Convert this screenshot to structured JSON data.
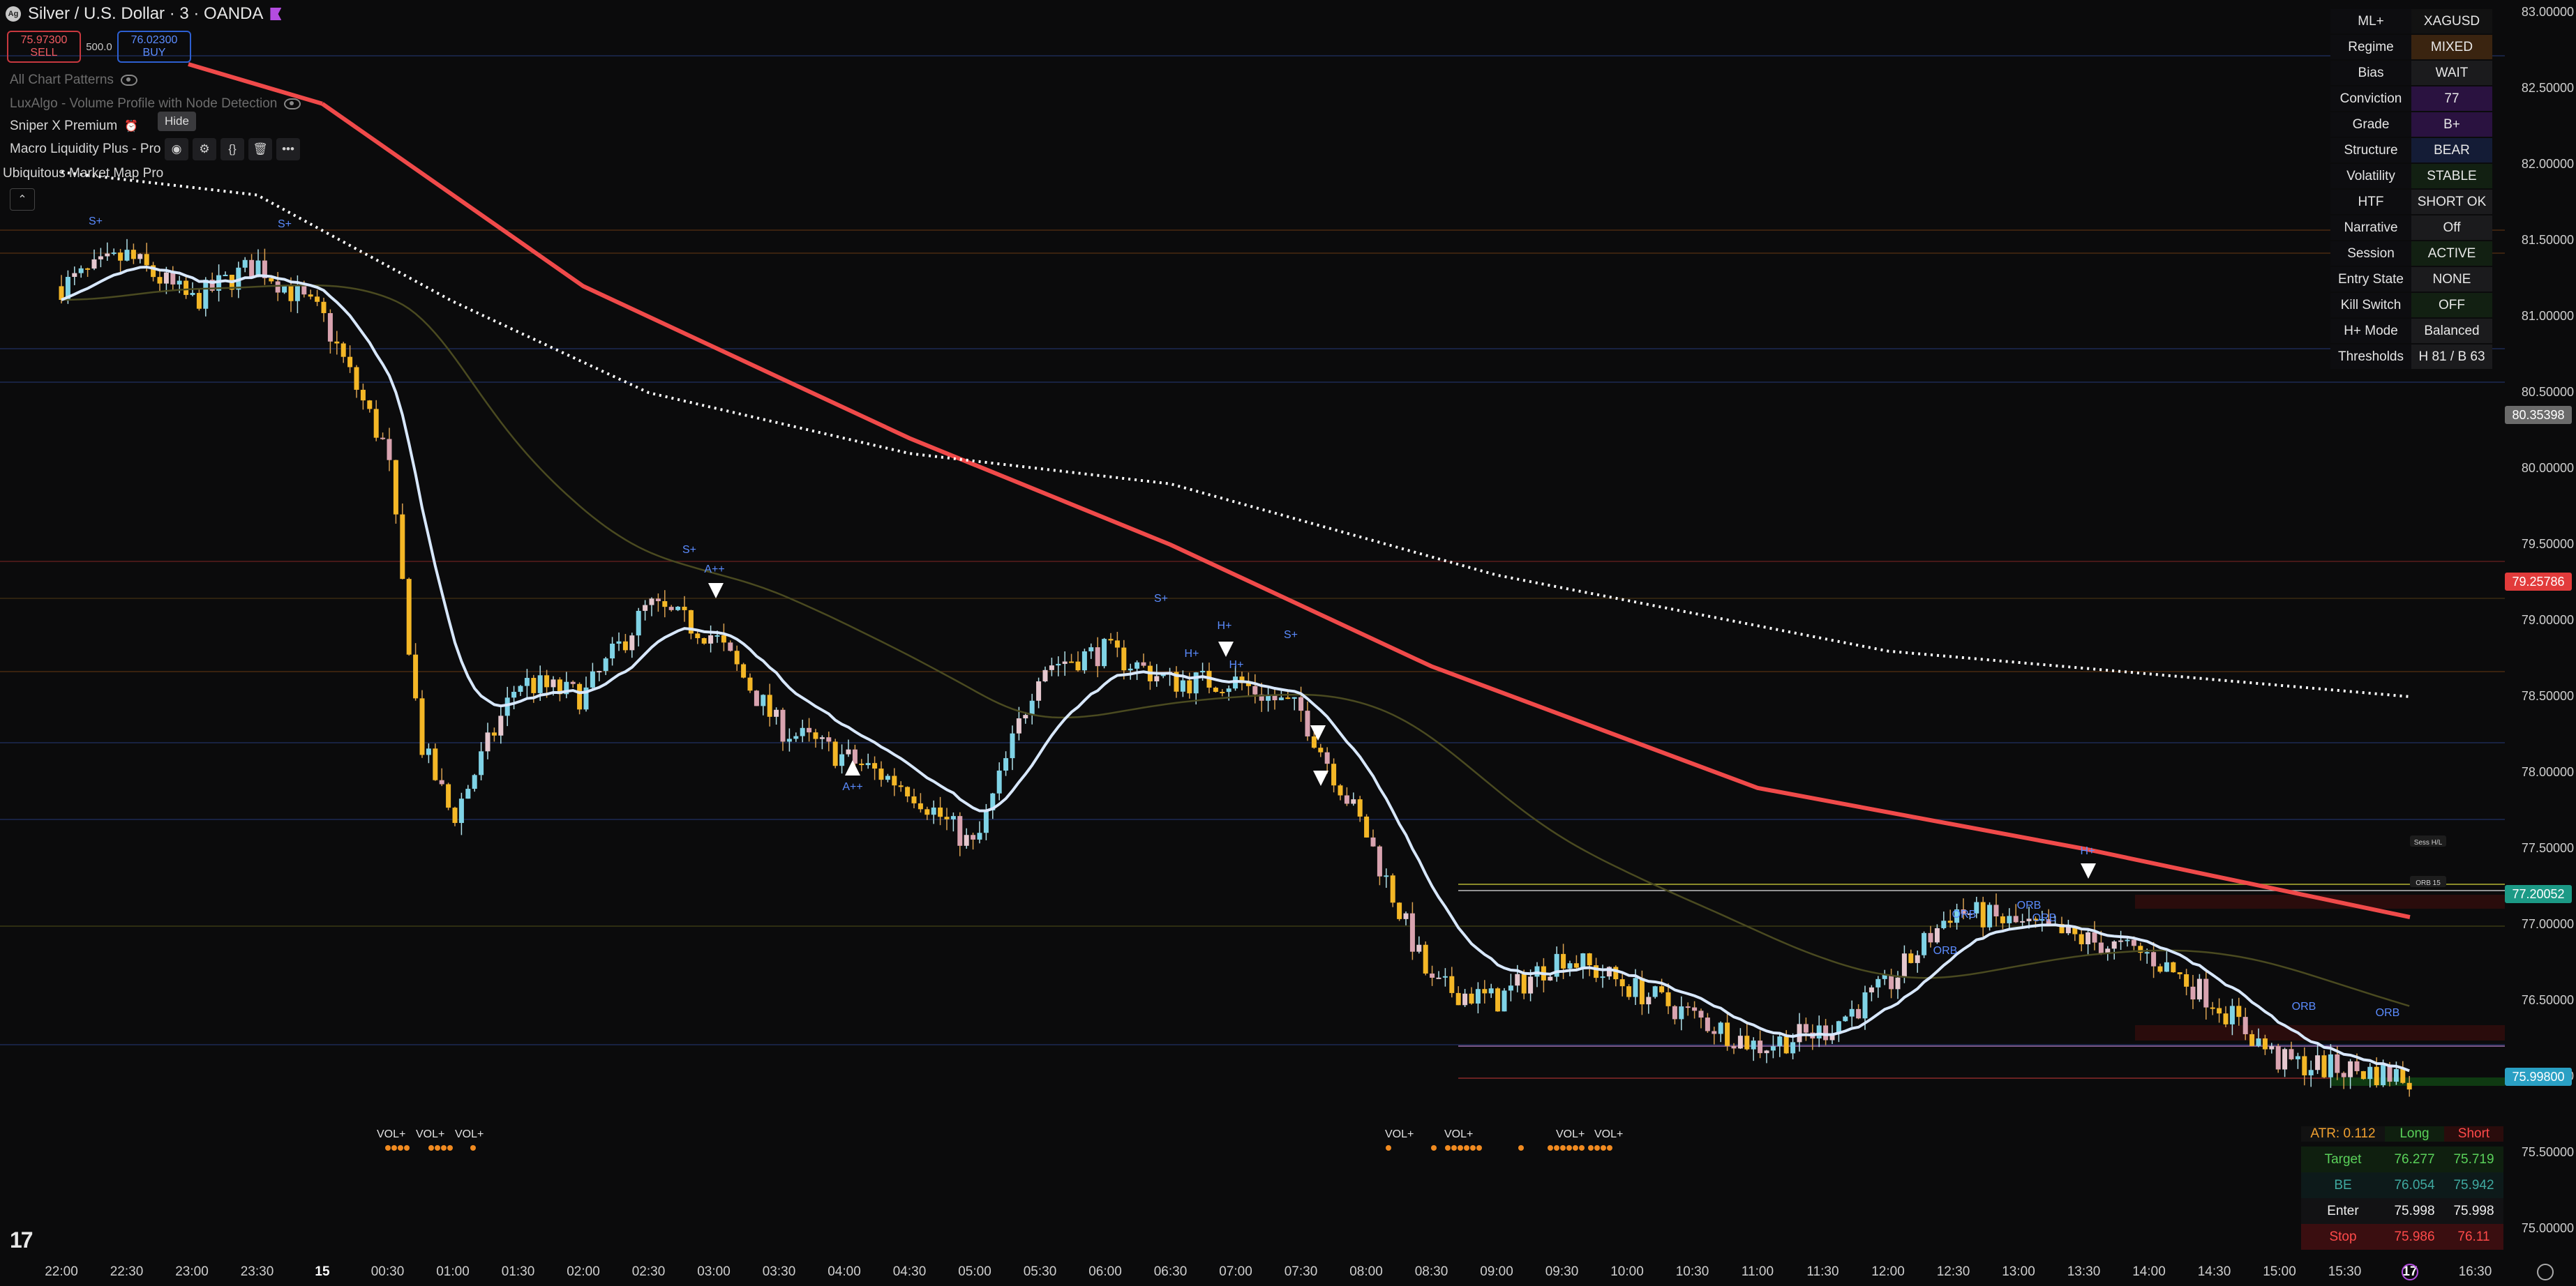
{
  "header": {
    "title": "Silver / U.S. Dollar · 3 · OANDA",
    "sell_price": "75.97300",
    "sell_label": "SELL",
    "qty": "500.0",
    "buy_price": "76.02300",
    "buy_label": "BUY"
  },
  "indicators": {
    "chart_patterns": "All Chart Patterns",
    "luxalgo": "LuxAlgo - Volume Profile with Node Detection",
    "sniper": "Sniper X Premium",
    "macro": "Macro Liquidity Plus - Pro",
    "ubiquitous": "Ubiquitous Market Map Pro",
    "hide_tooltip": "Hide"
  },
  "dashboard": [
    {
      "key": "ML+",
      "value": "XAGUSD",
      "bg": "#121212"
    },
    {
      "key": "Regime",
      "value": "MIXED",
      "bg": "#3a2410"
    },
    {
      "key": "Bias",
      "value": "WAIT",
      "bg": "#1b1b1d"
    },
    {
      "key": "Conviction",
      "value": "77",
      "bg": "#2a1240"
    },
    {
      "key": "Grade",
      "value": "B+",
      "bg": "#2a1240"
    },
    {
      "key": "Structure",
      "value": "BEAR",
      "bg": "#141c36"
    },
    {
      "key": "Volatility",
      "value": "STABLE",
      "bg": "#122012"
    },
    {
      "key": "HTF",
      "value": "SHORT OK",
      "bg": "#1b1b1d"
    },
    {
      "key": "Narrative",
      "value": "Off",
      "bg": "#1b1b1d"
    },
    {
      "key": "Session",
      "value": "ACTIVE",
      "bg": "#122012"
    },
    {
      "key": "Entry State",
      "value": "NONE",
      "bg": "#1b1b1d"
    },
    {
      "key": "Kill Switch",
      "value": "OFF",
      "bg": "#122012"
    },
    {
      "key": "H+ Mode",
      "value": "Balanced",
      "bg": "#1b1b1d"
    },
    {
      "key": "Thresholds",
      "value": "H 81 / B 63",
      "bg": "#1b1b1d"
    }
  ],
  "trade_panel": {
    "atr": "ATR: 0.112",
    "long": "Long",
    "short": "Short",
    "rows": [
      {
        "label": "Target",
        "long": "76.277",
        "short": "75.719",
        "color": "#5ad15a",
        "bg": "#0f1f0f"
      },
      {
        "label": "BE",
        "long": "76.054",
        "short": "75.942",
        "color": "#3fa9a0",
        "bg": "#0d1a1a"
      },
      {
        "label": "Enter",
        "long": "75.998",
        "short": "75.998",
        "color": "#eeeeee",
        "bg": "#121214"
      },
      {
        "label": "Stop",
        "long": "75.986",
        "short": "76.11",
        "color": "#ff4a4a",
        "bg": "#3a0e10"
      }
    ]
  },
  "y_axis": [
    "83.00000",
    "82.50000",
    "82.00000",
    "81.50000",
    "81.00000",
    "80.50000",
    "80.00000",
    "79.50000",
    "79.00000",
    "78.50000",
    "78.00000",
    "77.50000",
    "77.00000",
    "76.50000",
    "76.00000",
    "75.50000",
    "75.00000"
  ],
  "price_tags": [
    {
      "value": "80.35398",
      "price": 80.354,
      "bg": "#6b6b6b",
      "fg": "#ffffff"
    },
    {
      "value": "79.25786",
      "price": 79.258,
      "bg": "#e23b3b",
      "fg": "#ffffff"
    },
    {
      "value": "77.20052",
      "price": 77.2,
      "bg": "#1c9a86",
      "fg": "#ffffff"
    },
    {
      "value": "75.99800",
      "price": 75.998,
      "bg": "#2aa0c4",
      "fg": "#ffffff"
    }
  ],
  "x_axis": [
    "22:00",
    "22:30",
    "23:00",
    "23:30",
    "15",
    "00:30",
    "01:00",
    "01:30",
    "02:00",
    "02:30",
    "03:00",
    "03:30",
    "04:00",
    "04:30",
    "05:00",
    "05:30",
    "06:00",
    "06:30",
    "07:00",
    "07:30",
    "08:00",
    "08:30",
    "09:00",
    "09:30",
    "10:00",
    "10:30",
    "11:00",
    "11:30",
    "12:00",
    "12:30",
    "13:00",
    "13:30",
    "14:00",
    "14:30",
    "15:00",
    "15:30",
    "17",
    "16:30"
  ],
  "signal_labels": [
    "S+",
    "S+",
    "S+",
    "A++",
    "A++",
    "S+",
    "H+",
    "H+",
    "H+",
    "S+",
    "H+",
    "ORB",
    "ORB",
    "ORB",
    "ORB",
    "ORB",
    "ORB"
  ],
  "vol_labels": [
    "VOL+",
    "VOL+",
    "VOL+",
    "VOL+",
    "VOL+",
    "VOL+",
    "VOL+"
  ],
  "line_labels": [
    "Sess H/L",
    "ORB 15"
  ],
  "chart_data": {
    "type": "candlestick",
    "symbol": "XAGUSD",
    "ylim": [
      75.0,
      83.0
    ],
    "close_path": [
      {
        "t": "22:00",
        "p": 81.2
      },
      {
        "t": "22:30",
        "p": 81.4
      },
      {
        "t": "23:00",
        "p": 81.1
      },
      {
        "t": "23:30",
        "p": 81.35
      },
      {
        "t": "00:00",
        "p": 81.0
      },
      {
        "t": "00:30",
        "p": 80.1
      },
      {
        "t": "00:45",
        "p": 78.2
      },
      {
        "t": "01:00",
        "p": 77.7
      },
      {
        "t": "01:30",
        "p": 78.6
      },
      {
        "t": "02:00",
        "p": 78.5
      },
      {
        "t": "02:30",
        "p": 79.1
      },
      {
        "t": "03:00",
        "p": 78.9
      },
      {
        "t": "03:30",
        "p": 78.3
      },
      {
        "t": "04:00",
        "p": 78.1
      },
      {
        "t": "04:30",
        "p": 77.9
      },
      {
        "t": "05:00",
        "p": 77.5
      },
      {
        "t": "05:30",
        "p": 78.7
      },
      {
        "t": "06:00",
        "p": 78.8
      },
      {
        "t": "06:30",
        "p": 78.6
      },
      {
        "t": "07:00",
        "p": 78.6
      },
      {
        "t": "07:30",
        "p": 78.4
      },
      {
        "t": "08:00",
        "p": 77.6
      },
      {
        "t": "08:30",
        "p": 76.6
      },
      {
        "t": "09:00",
        "p": 76.5
      },
      {
        "t": "09:30",
        "p": 76.8
      },
      {
        "t": "10:00",
        "p": 76.6
      },
      {
        "t": "10:30",
        "p": 76.4
      },
      {
        "t": "11:00",
        "p": 76.2
      },
      {
        "t": "11:30",
        "p": 76.3
      },
      {
        "t": "12:00",
        "p": 76.6
      },
      {
        "t": "12:30",
        "p": 77.1
      },
      {
        "t": "13:00",
        "p": 77.0
      },
      {
        "t": "13:30",
        "p": 76.9
      },
      {
        "t": "14:00",
        "p": 76.8
      },
      {
        "t": "14:30",
        "p": 76.5
      },
      {
        "t": "15:00",
        "p": 76.1
      },
      {
        "t": "15:30",
        "p": 76.05
      },
      {
        "t": "16:00",
        "p": 76.0
      }
    ],
    "ma_slow_red": [
      {
        "t": "00:00",
        "p": 82.4
      },
      {
        "t": "02:00",
        "p": 81.2
      },
      {
        "t": "04:30",
        "p": 80.2
      },
      {
        "t": "06:30",
        "p": 79.5
      },
      {
        "t": "08:30",
        "p": 78.7
      },
      {
        "t": "11:00",
        "p": 77.9
      },
      {
        "t": "13:30",
        "p": 77.5
      },
      {
        "t": "16:00",
        "p": 77.05
      }
    ],
    "ma_dotted_white": [
      {
        "t": "22:00",
        "p": 81.95
      },
      {
        "t": "23:30",
        "p": 81.8
      },
      {
        "t": "01:00",
        "p": 81.1
      },
      {
        "t": "02:30",
        "p": 80.5
      },
      {
        "t": "04:30",
        "p": 80.1
      },
      {
        "t": "06:30",
        "p": 79.9
      },
      {
        "t": "09:00",
        "p": 79.3
      },
      {
        "t": "12:00",
        "p": 78.8
      },
      {
        "t": "16:00",
        "p": 78.5
      }
    ]
  }
}
